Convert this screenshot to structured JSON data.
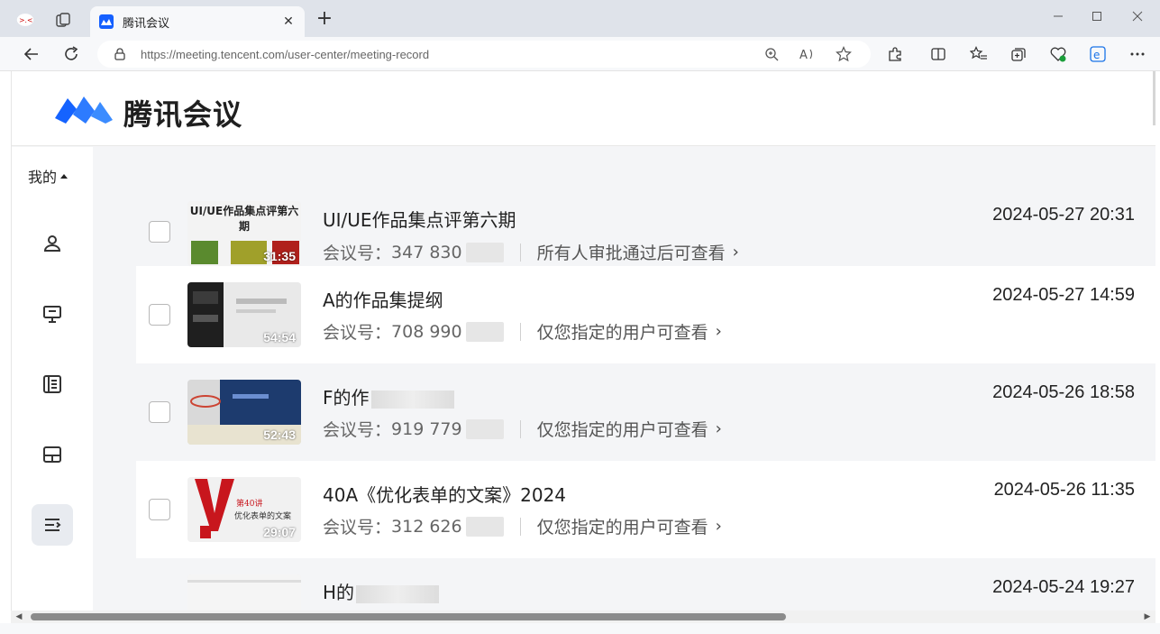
{
  "browser": {
    "tab_title": "腾讯会议",
    "url": "https://meeting.tencent.com/user-center/meeting-record",
    "tab_close": "✕",
    "new_tab": "+"
  },
  "header": {
    "logo_text": "腾讯会议",
    "brand_color": "#1560ff"
  },
  "sidebar": {
    "mine_label": "我的",
    "icons": [
      "user-icon",
      "presentation-icon",
      "document-list-icon",
      "layout-icon",
      "record-list-icon"
    ],
    "active_index": 4
  },
  "meetings": [
    {
      "title": "UI/UE作品集点评第六期",
      "id_label": "会议号：",
      "id_value": "347 830",
      "permission": "所有人审批通过后可查看",
      "date": "2024-05-27 20:31",
      "duration": "31:35",
      "thumb_caption": "UI/UE作品集点评 第六期",
      "thumb_line2": "第六期"
    },
    {
      "title": "A的作品集提纲",
      "id_label": "会议号：",
      "id_value": "708 990",
      "permission": "仅您指定的用户可查看",
      "date": "2024-05-27 14:59",
      "duration": "54:54"
    },
    {
      "title": "F的作",
      "id_label": "会议号：",
      "id_value": "919 779",
      "permission": "仅您指定的用户可查看",
      "date": "2024-05-26 18:58",
      "duration": "52:43"
    },
    {
      "title": "40A《优化表单的文案》2024",
      "id_label": "会议号：",
      "id_value": "312 626",
      "permission": "仅您指定的用户可查看",
      "date": "2024-05-26 11:35",
      "duration": "29:07",
      "thumb_caption": "第40讲",
      "thumb_line2": "优化表单的文案"
    },
    {
      "title": "H的",
      "date": "2024-05-24 19:27"
    }
  ]
}
